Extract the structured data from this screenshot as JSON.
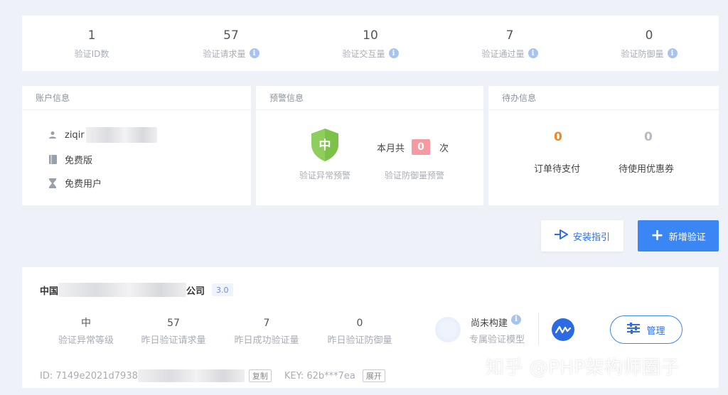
{
  "stats": [
    {
      "value": "1",
      "label": "验证ID数",
      "info": false
    },
    {
      "value": "57",
      "label": "验证请求量",
      "info": true
    },
    {
      "value": "10",
      "label": "验证交互量",
      "info": true
    },
    {
      "value": "7",
      "label": "验证通过量",
      "info": true
    },
    {
      "value": "0",
      "label": "验证防御量",
      "info": true
    }
  ],
  "account": {
    "title": "账户信息",
    "username": "ziqir",
    "plan": "免费版",
    "user_type": "免费用户"
  },
  "warning": {
    "title": "预警信息",
    "level": "中",
    "level_label": "验证异常预警",
    "month_prefix": "本月共",
    "count": "0",
    "month_suffix": "次",
    "defense_label": "验证防御量预警"
  },
  "todo": {
    "title": "待办信息",
    "orders_count": "0",
    "orders_label": "订单待支付",
    "coupons_count": "0",
    "coupons_label": "待使用优惠券"
  },
  "buttons": {
    "guide": "安装指引",
    "new": "新增验证"
  },
  "project": {
    "name_prefix": "中国",
    "name_suffix": "公司",
    "version": "3.0",
    "stats": [
      {
        "value": "中",
        "label": "验证异常等级"
      },
      {
        "value": "57",
        "label": "昨日验证请求量"
      },
      {
        "value": "7",
        "label": "昨日成功验证量"
      },
      {
        "value": "0",
        "label": "昨日验证防御量"
      }
    ],
    "model_status": "尚未构建",
    "model_label": "专属验证模型",
    "manage": "管理",
    "id_text": "ID: 7149e2021d7938",
    "copy": "复制",
    "key_text": "KEY: 62b***7ea",
    "expand": "展开"
  },
  "watermark": "知乎 @PHP架构师圈子",
  "colors": {
    "primary": "#3a86f5",
    "todo_orange": "#f0862a",
    "todo_grey": "#b5bac4",
    "shield_green": "#8fce5c",
    "badge_red": "#f59aa0"
  }
}
